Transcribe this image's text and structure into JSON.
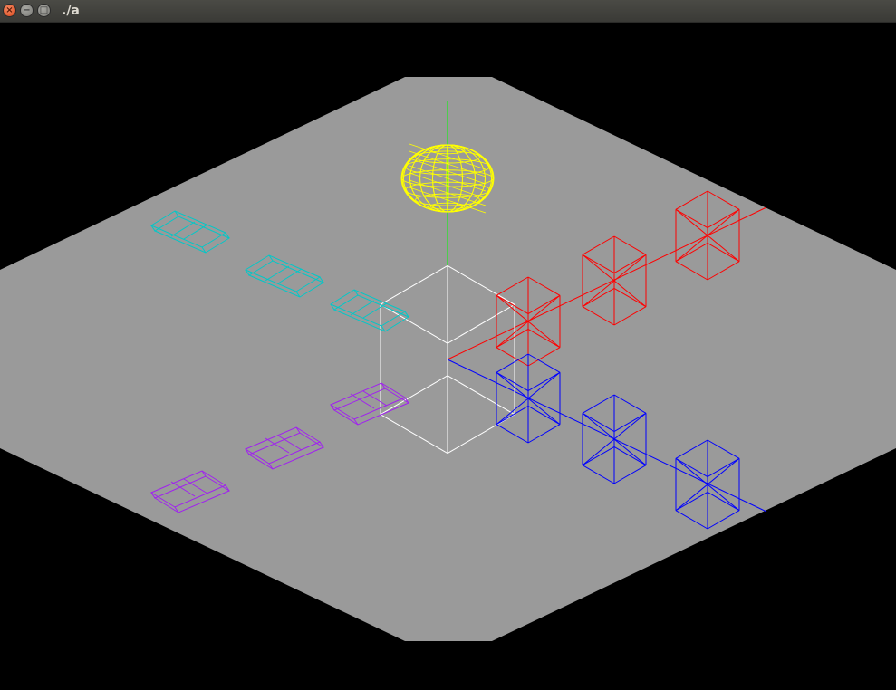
{
  "window": {
    "title": "./a",
    "controls": {
      "close": "×",
      "minimize": "−",
      "maximize": "□"
    }
  },
  "scene": {
    "background_color": "#000000",
    "plane_color": "#9a9a9a",
    "colors": {
      "x_axis": "#ff0000",
      "y_axis": "#00ff00",
      "z_axis": "#0000ff",
      "center_cube": "#ffffff",
      "sphere": "#ffff00",
      "cyan_boxes": "#00c8c8",
      "purple_boxes": "#a020f0",
      "red_cubes": "#ff0000",
      "blue_cubes": "#0000ff"
    }
  }
}
